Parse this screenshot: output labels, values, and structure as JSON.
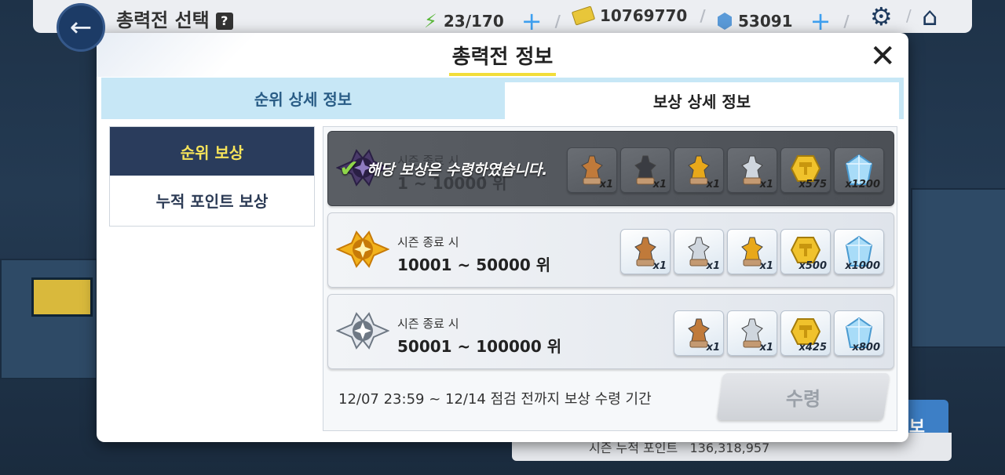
{
  "topbar": {
    "title": "총력전 선택",
    "help_label": "?",
    "stamina": "23/170",
    "credits": "10769770",
    "gems": "53091"
  },
  "modal": {
    "title": "총력전 정보",
    "tabs": [
      {
        "label": "순위 상세 정보"
      },
      {
        "label": "보상 상세 정보"
      }
    ],
    "menu": [
      {
        "label": "순위 보상"
      },
      {
        "label": "누적 포인트 보상"
      }
    ],
    "rows": [
      {
        "subtitle": "시즌 종료 시",
        "rank": "1 ~ 10000 위",
        "claimed": true,
        "claimed_text": "해당 보상은 수령하였습니다.",
        "items": [
          {
            "type": "bronze-mech",
            "qty": "x1"
          },
          {
            "type": "black-mech",
            "qty": "x1"
          },
          {
            "type": "gold-mech",
            "qty": "x1"
          },
          {
            "type": "silver-mech",
            "qty": "x1"
          },
          {
            "type": "gold-token",
            "qty": "x575"
          },
          {
            "type": "crystal",
            "qty": "x1200"
          }
        ]
      },
      {
        "subtitle": "시즌 종료 시",
        "rank": "10001 ~ 50000 위",
        "claimed": false,
        "items": [
          {
            "type": "bronze-mech",
            "qty": "x1"
          },
          {
            "type": "silver-mech",
            "qty": "x1"
          },
          {
            "type": "gold-mech",
            "qty": "x1"
          },
          {
            "type": "gold-token",
            "qty": "x500"
          },
          {
            "type": "crystal",
            "qty": "x1000"
          }
        ]
      },
      {
        "subtitle": "시즌 종료 시",
        "rank": "50001 ~ 100000 위",
        "claimed": false,
        "items": [
          {
            "type": "bronze-mech",
            "qty": "x1"
          },
          {
            "type": "silver-mech",
            "qty": "x1"
          },
          {
            "type": "gold-token",
            "qty": "x425"
          },
          {
            "type": "crystal",
            "qty": "x800"
          }
        ]
      }
    ],
    "period": "12/07 23:59 ~ 12/14 점검 전까지 보상 수령 기간",
    "claim_label": "수령"
  },
  "background": {
    "points_label": "시즌 누적 포인트",
    "points_value": "136,318,957",
    "side_button": "정보"
  },
  "colors": {
    "accent_yellow": "#f2dd3a",
    "tab_active_bg": "#c7e7f6",
    "menu_active_bg": "#2a3c5c"
  }
}
